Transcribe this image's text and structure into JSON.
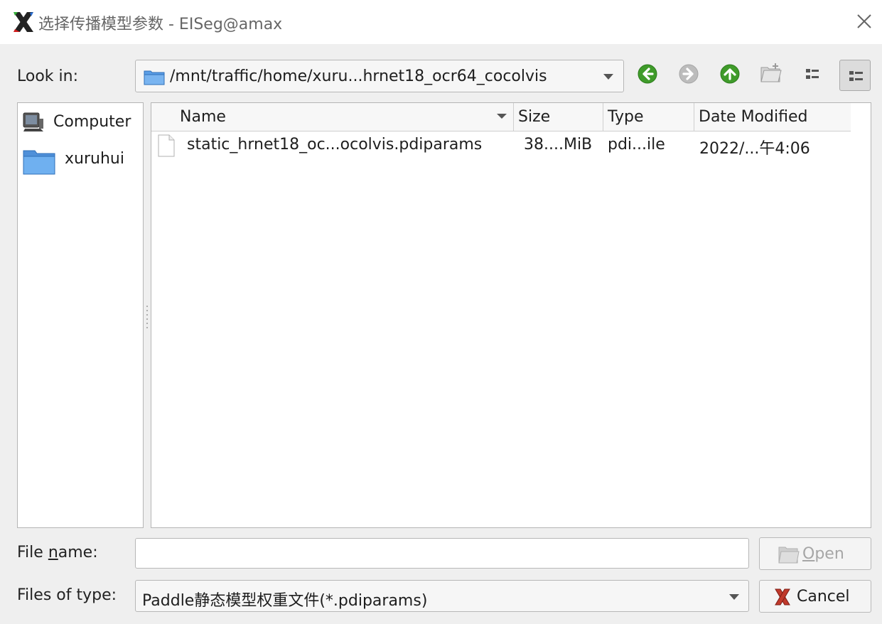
{
  "window": {
    "title": "选择传播模型参数 - EISeg@amax"
  },
  "toolbar": {
    "look_in_label": "Look in:",
    "path": "/mnt/traffic/home/xuru...hrnet18_ocr64_cocolvis",
    "buttons": [
      "back-icon",
      "forward-icon",
      "parent-directory-icon",
      "new-folder-icon",
      "list-view-icon",
      "detail-view-icon"
    ]
  },
  "sidebar": {
    "items": [
      {
        "label": "Computer",
        "icon": "computer-icon"
      },
      {
        "label": "xuruhui",
        "icon": "folder-icon"
      }
    ]
  },
  "file_table": {
    "columns": [
      "Name",
      "Size",
      "Type",
      "Date Modified"
    ],
    "rows": [
      {
        "name": "static_hrnet18_oc...ocolvis.pdiparams",
        "size": "38....MiB",
        "type": "pdi...ile",
        "date": "2022/...午4:06"
      }
    ]
  },
  "footer": {
    "file_name_label_pre": "File ",
    "file_name_label_ul": "n",
    "file_name_label_post": "ame:",
    "file_name_value": "",
    "files_of_type_label": "Files of type:",
    "files_of_type_value": "Paddle静态模型权重文件(*.pdiparams)",
    "open_label_ul": "O",
    "open_label_rest": "pen",
    "cancel_label": "Cancel"
  },
  "colors": {
    "accent_green": "#3f9b2a",
    "folder_blue": "#4a8fd6",
    "cancel_red": "#c0392b"
  }
}
